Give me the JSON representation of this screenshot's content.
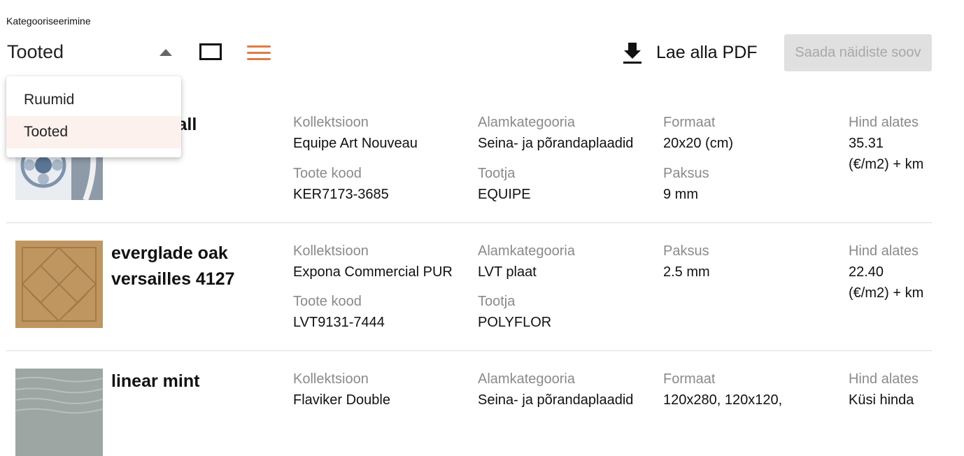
{
  "filter": {
    "label": "Kategooriseerimine",
    "selected": "Tooted",
    "options": [
      "Ruumid",
      "Tooted"
    ]
  },
  "toolbar": {
    "download_label": "Lae alla PDF",
    "sample_request_label": "Saada näidiste soov",
    "accent_color": "#e07a45"
  },
  "products": [
    {
      "name": "music hall",
      "fields": [
        {
          "label": "Kollektsioon",
          "value": "Equipe Art Nouveau"
        },
        {
          "label": "Alamkategooria",
          "value": "Seina- ja põrandaplaadid"
        },
        {
          "label": "Formaat",
          "value": "20x20 (cm)"
        },
        {
          "label": "Hind alates",
          "value": "35.31",
          "value2": "(€/m2) + km"
        },
        {
          "label": "Toote kood",
          "value": "KER7173-3685"
        },
        {
          "label": "Tootja",
          "value": "EQUIPE"
        },
        {
          "label": "Paksus",
          "value": "9 mm"
        }
      ]
    },
    {
      "name_line1": "everglade oak",
      "name_line2": "versailles 4127",
      "fields": [
        {
          "label": "Kollektsioon",
          "value": "Expona Commercial PUR"
        },
        {
          "label": "Alamkategooria",
          "value": "LVT plaat"
        },
        {
          "label": "Paksus",
          "value": "2.5 mm"
        },
        {
          "label": "Hind alates",
          "value": "22.40",
          "value2": "(€/m2) + km"
        },
        {
          "label": "Toote kood",
          "value": "LVT9131-7444"
        },
        {
          "label": "Tootja",
          "value": "POLYFLOR"
        }
      ]
    },
    {
      "name": "linear mint",
      "fields": [
        {
          "label": "Kollektsioon",
          "value": "Flaviker Double"
        },
        {
          "label": "Alamkategooria",
          "value": "Seina- ja põrandaplaadid"
        },
        {
          "label": "Formaat",
          "value": "120x280, 120x120,"
        },
        {
          "label": "Hind alates",
          "value": "Küsi hinda"
        }
      ]
    }
  ]
}
